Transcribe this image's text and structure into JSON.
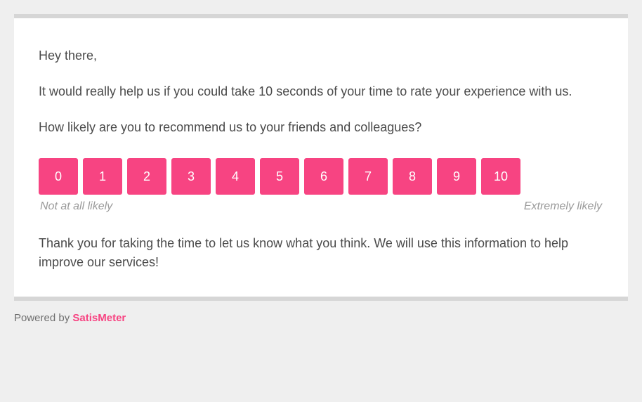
{
  "survey": {
    "greeting": "Hey there,",
    "intro": "It would really help us if you could take 10 seconds of your time to rate your experience with us.",
    "question": "How likely are you to recommend us to your friends and colleagues?",
    "ratings": [
      "0",
      "1",
      "2",
      "3",
      "4",
      "5",
      "6",
      "7",
      "8",
      "9",
      "10"
    ],
    "labels": {
      "low": "Not at all likely",
      "high": "Extremely likely"
    },
    "thanks": "Thank you for taking the time to let us know what you think. We will use this information to help improve our services!"
  },
  "footer": {
    "powered_label": "Powered by ",
    "brand": "SatisMeter"
  },
  "colors": {
    "accent": "#f74482"
  }
}
